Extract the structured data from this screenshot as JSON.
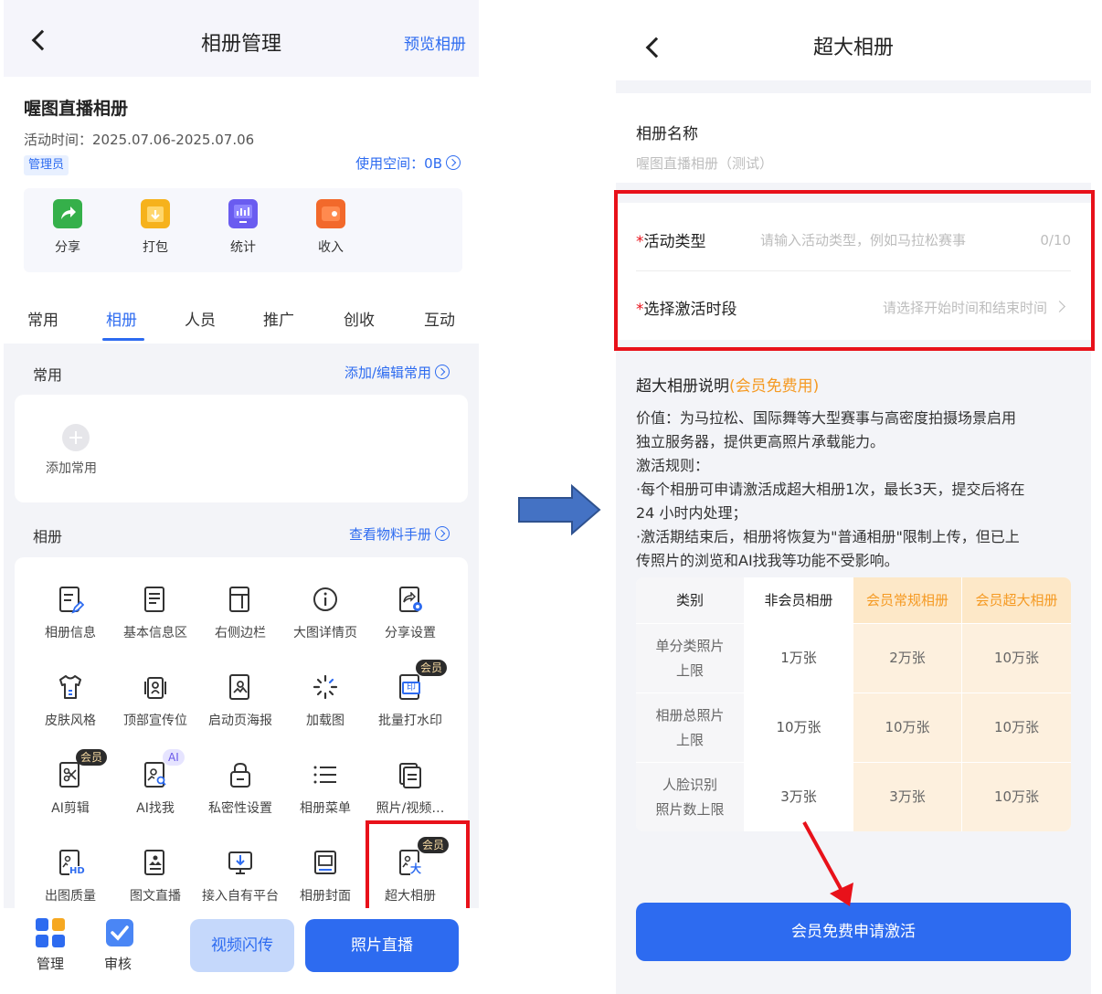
{
  "left": {
    "header": {
      "title": "相册管理",
      "preview_link": "预览相册"
    },
    "album": {
      "name": "喔图直播相册",
      "activity_time": "活动时间：2025.07.06-2025.07.06",
      "role_badge": "管理员",
      "usage": "使用空间：0B"
    },
    "quick_actions": [
      {
        "label": "分享",
        "icon": "share-icon",
        "color": "#35b04a"
      },
      {
        "label": "打包",
        "icon": "package-icon",
        "color": "#f6b21c"
      },
      {
        "label": "统计",
        "icon": "statistics-icon",
        "color": "#6a5cf0"
      },
      {
        "label": "收入",
        "icon": "income-icon",
        "color": "#f2692b"
      }
    ],
    "tabs": [
      "常用",
      "相册",
      "人员",
      "推广",
      "创收",
      "互动"
    ],
    "active_tab": "相册",
    "common_section": {
      "title": "常用",
      "link": "添加/编辑常用",
      "add_label": "添加常用"
    },
    "album_section": {
      "title": "相册",
      "link": "查看物料手册",
      "items": [
        {
          "label": "相册信息",
          "icon": "album-info-icon"
        },
        {
          "label": "基本信息区",
          "icon": "basic-info-icon"
        },
        {
          "label": "右侧边栏",
          "icon": "right-sidebar-icon"
        },
        {
          "label": "大图详情页",
          "icon": "info-circle-icon"
        },
        {
          "label": "分享设置",
          "icon": "share-settings-icon"
        },
        {
          "label": "皮肤风格",
          "icon": "tshirt-icon"
        },
        {
          "label": "顶部宣传位",
          "icon": "top-banner-icon"
        },
        {
          "label": "启动页海报",
          "icon": "poster-icon"
        },
        {
          "label": "加载图",
          "icon": "loading-icon"
        },
        {
          "label": "批量打水印",
          "icon": "watermark-icon",
          "badge": "会员"
        },
        {
          "label": "AI剪辑",
          "icon": "ai-clip-icon",
          "badge": "会员"
        },
        {
          "label": "AI找我",
          "icon": "ai-find-icon",
          "badge_ai": "AI"
        },
        {
          "label": "私密性设置",
          "icon": "lock-icon"
        },
        {
          "label": "相册菜单",
          "icon": "menu-list-icon"
        },
        {
          "label": "照片/视频…",
          "icon": "photo-video-icon"
        },
        {
          "label": "出图质量",
          "icon": "hd-quality-icon"
        },
        {
          "label": "图文直播",
          "icon": "image-text-live-icon"
        },
        {
          "label": "接入自有平台",
          "icon": "platform-access-icon"
        },
        {
          "label": "相册封面",
          "icon": "album-cover-icon"
        },
        {
          "label": "超大相册",
          "icon": "large-album-icon",
          "badge": "会员"
        }
      ]
    },
    "bottom": {
      "manage": "管理",
      "review": "审核",
      "video_flash": "视频闪传",
      "photo_live": "照片直播"
    }
  },
  "right": {
    "header": {
      "title": "超大相册"
    },
    "album_name_label": "相册名称",
    "album_name_value": "喔图直播相册（测试）",
    "activity_type": {
      "required": "*",
      "label": "活动类型",
      "placeholder": "请输入活动类型，例如马拉松赛事",
      "counter": "0/10"
    },
    "activation_period": {
      "required": "*",
      "label": "选择激活时段",
      "placeholder": "请选择开始时间和结束时间"
    },
    "description": {
      "title": "超大相册说明",
      "title_tag": "(会员免费用)",
      "lines": [
        "价值：为马拉松、国际舞等大型赛事与高密度拍摄场景启用",
        "独立服务器，提供更高照片承载能力。",
        "激活规则：",
        "·每个相册可申请激活成超大相册1次，最长3天，提交后将在",
        "24 小时内处理；",
        "·激活期结束后，相册将恢复为\"普通相册\"限制上传，但已上",
        "传照片的浏览和AI找我等功能不受影响。"
      ]
    },
    "table": {
      "headers": [
        "类别",
        "非会员相册",
        "会员常规相册",
        "会员超大相册"
      ],
      "rows": [
        {
          "category_line1": "单分类照片",
          "category_line2": "上限",
          "values": [
            "1万张",
            "2万张",
            "10万张"
          ]
        },
        {
          "category_line1": "相册总照片",
          "category_line2": "上限",
          "values": [
            "10万张",
            "10万张",
            "10万张"
          ]
        },
        {
          "category_line1": "人脸识别",
          "category_line2": "照片数上限",
          "values": [
            "3万张",
            "3万张",
            "10万张"
          ]
        }
      ]
    },
    "apply_button": "会员免费申请激活"
  },
  "colors": {
    "accent": "#2d6bf0",
    "highlight_red": "#e8111a",
    "member_orange": "#f59a23",
    "member_col_bg": "#fdf0de"
  }
}
